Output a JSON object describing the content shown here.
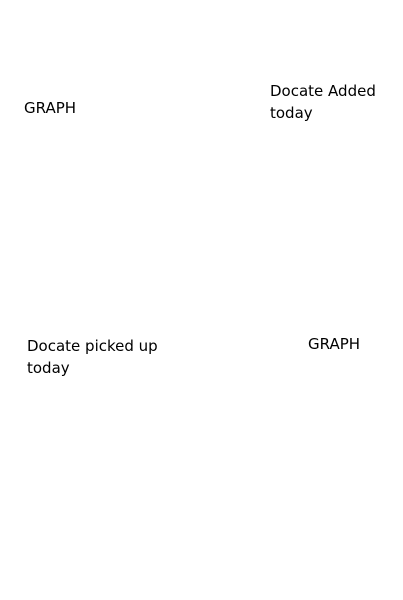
{
  "panels": {
    "top_left_graph_label": "GRAPH",
    "docs_added_label": "Docate Added today",
    "docs_picked_label": "Docate picked up today",
    "bottom_right_graph_label": "GRAPH"
  }
}
